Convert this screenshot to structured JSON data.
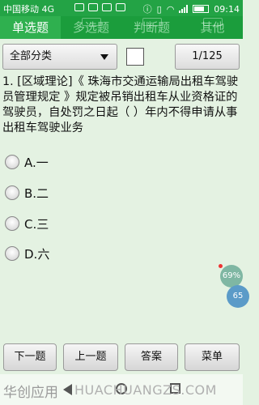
{
  "status": {
    "carrier": "中国移动 4G",
    "network": "4G",
    "time": "09:14"
  },
  "tabs": [
    {
      "label": "单选题",
      "active": true
    },
    {
      "label": "多选题",
      "active": false
    },
    {
      "label": "判断题",
      "active": false
    },
    {
      "label": "其他",
      "active": false
    }
  ],
  "toolbar": {
    "category": "全部分类",
    "page_indicator": "1/125"
  },
  "question": {
    "text": "1. [区域理论]《 珠海市交通运输局出租车驾驶员管理规定 》规定被吊销出租车从业资格证的驾驶员，自处罚之日起（ ）年内不得申请从事出租车驾驶业务"
  },
  "options": [
    {
      "label": "A.一"
    },
    {
      "label": "B.二"
    },
    {
      "label": "C.三"
    },
    {
      "label": "D.六"
    }
  ],
  "floating": {
    "badge1": "69%",
    "badge2": "65"
  },
  "buttons": {
    "next": "下一题",
    "prev": "上一题",
    "answer": "答案",
    "menu": "菜单"
  },
  "watermark": {
    "cn": "华创应用",
    "en": "HUACHUANGZS.COM"
  },
  "colors": {
    "accent": "#1b9d3c",
    "background": "#e4f2e2"
  }
}
